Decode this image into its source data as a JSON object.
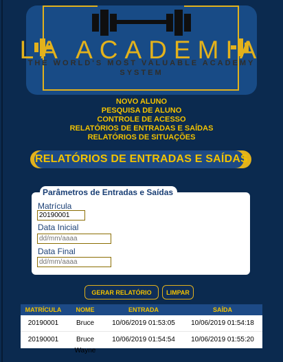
{
  "app": {
    "logo": {
      "title": "LA ACADEMIA",
      "subtitle_1": "THE WORLD'S MOST VALUABLE ACADEMY",
      "subtitle_2": "SYSTEM",
      "accent_color": "#e3b21c",
      "panel_color": "#184b86"
    },
    "nav": {
      "items": [
        "NOVO ALUNO",
        "PESQUISA DE ALUNO",
        "CONTROLE DE ACESSO",
        "RELATÓRIOS DE ENTRADAS E SAÍDAS",
        "RELATÓRIOS DE SITUAÇÕES"
      ],
      "text_color": "#f2c200"
    },
    "section": {
      "title": "RELATÓRIOS DE ENTRADAS E SAÍDAS"
    },
    "form": {
      "legend": "Parâmetros de Entradas e Saídas",
      "fields": {
        "matricula": {
          "label": "Matrícula",
          "value": "20190001"
        },
        "data_inicial": {
          "label": "Data Inicial",
          "placeholder": "dd/mm/aaaa"
        },
        "data_final": {
          "label": "Data Final",
          "placeholder": "dd/mm/aaaa"
        }
      }
    },
    "actions": {
      "gerar": "GERAR RELATÓRIO",
      "limpar": "LIMPAR"
    },
    "table": {
      "headers": [
        "MATRÍCULA",
        "NOME",
        "ENTRADA",
        "SAÍDA"
      ],
      "rows": [
        [
          "20190001",
          "Bruce Wayne",
          "10/06/2019 01:53:05",
          "10/06/2019 01:54:18"
        ],
        [
          "20190001",
          "Bruce Wayne",
          "10/06/2019 01:54:54",
          "10/06/2019 01:55:20"
        ]
      ]
    }
  }
}
